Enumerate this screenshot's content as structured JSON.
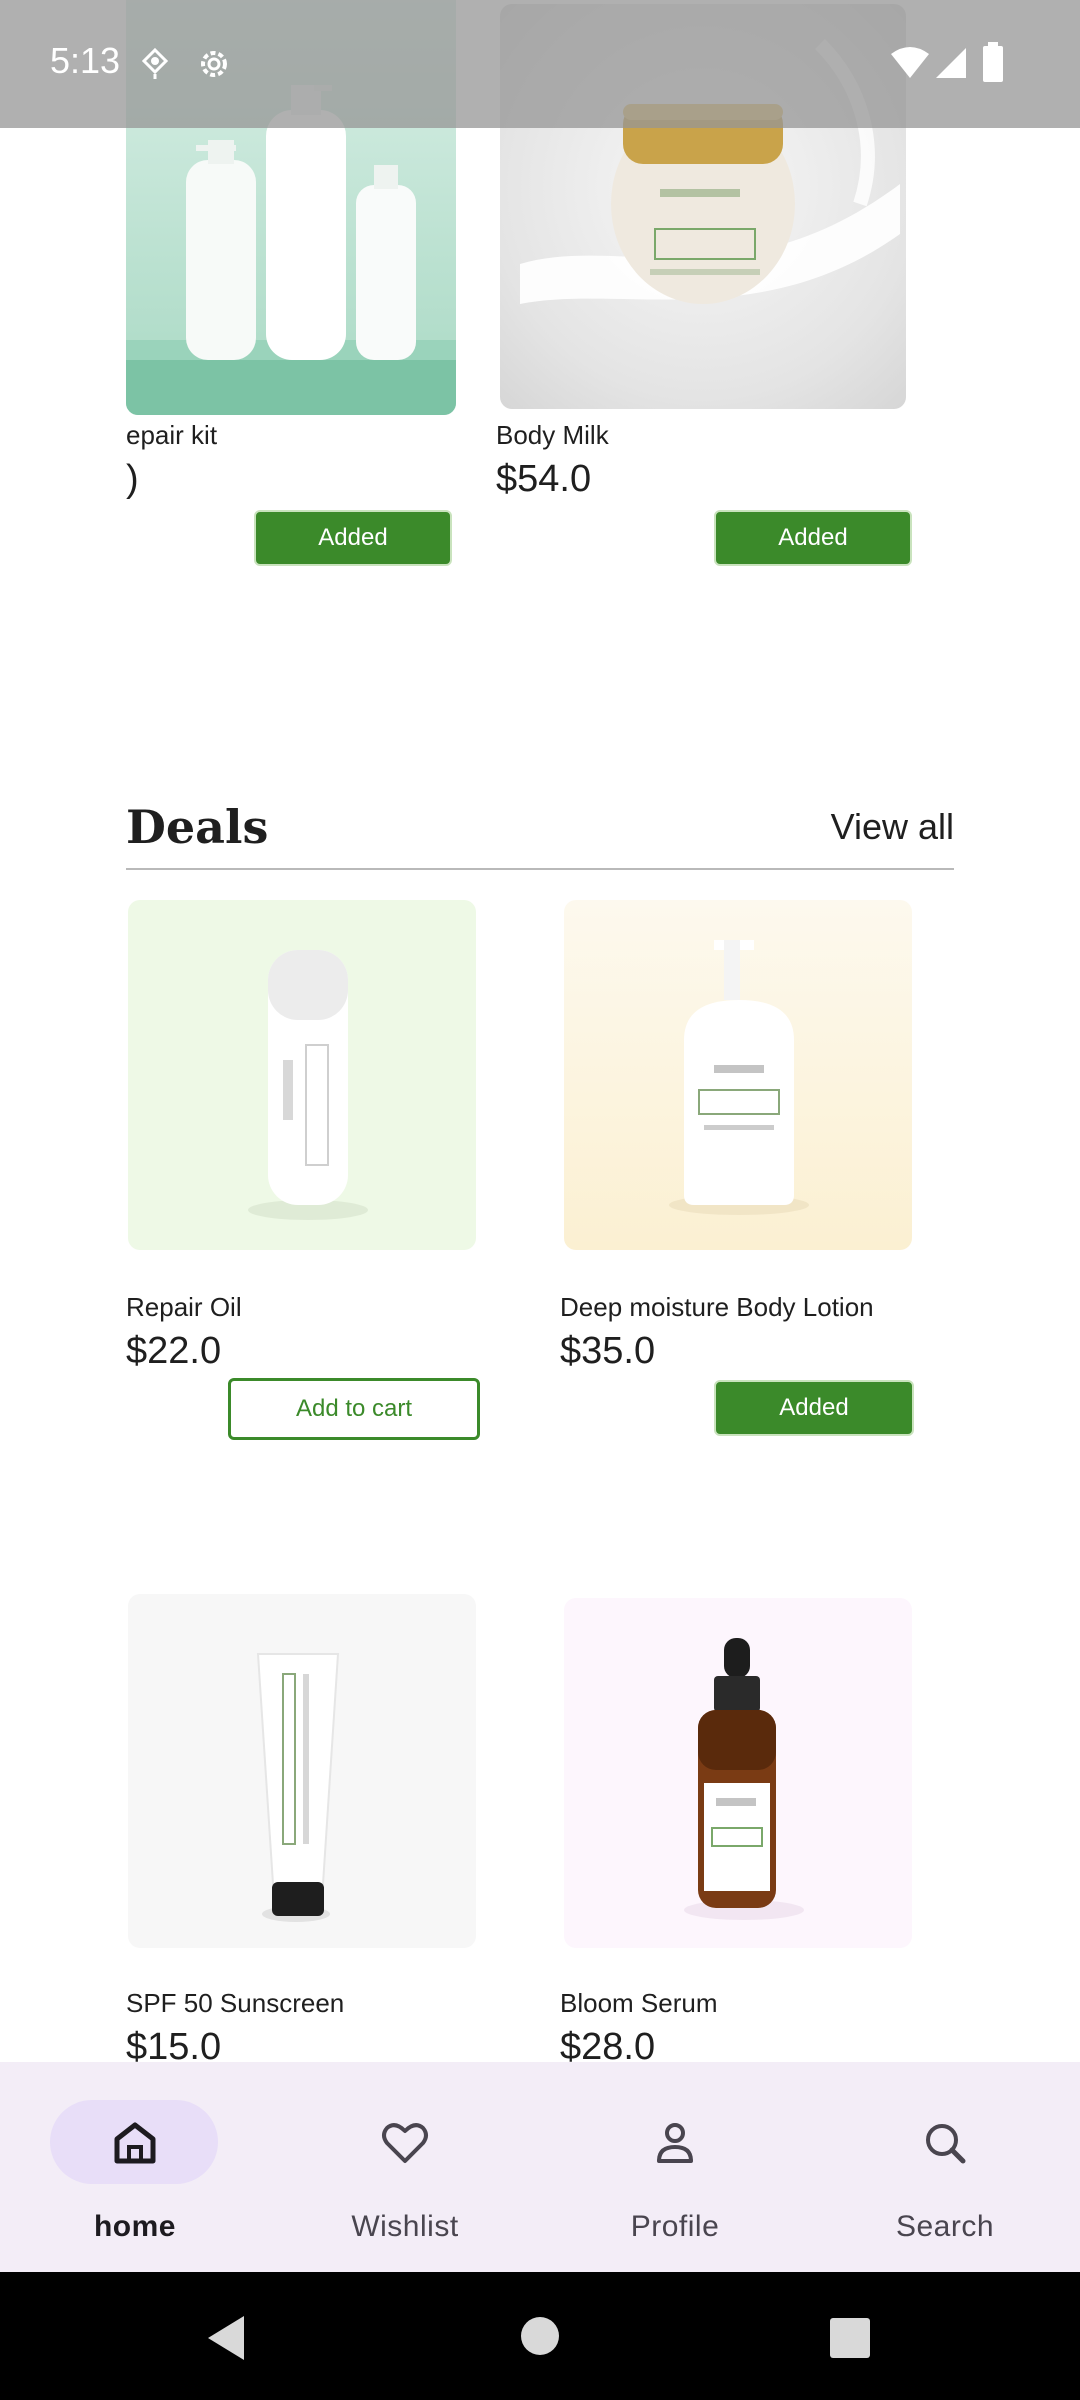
{
  "status_bar": {
    "time": "5:13",
    "icons": [
      "location-pin-icon",
      "gear-icon",
      "wifi-icon",
      "signal-icon",
      "battery-icon"
    ]
  },
  "top_products": [
    {
      "name": "epair kit",
      "price": ")",
      "button": "Added",
      "image": "pump-bottles-on-mint-image"
    },
    {
      "name": "Body Milk",
      "price": "$54.0",
      "button": "Added",
      "image": "cream-jar-milk-splash-image"
    }
  ],
  "deals": {
    "title": "Deals",
    "view_all": "View all",
    "products": [
      {
        "name": "Repair Oil",
        "price": "$22.0",
        "button": "Add to cart",
        "image": "white-airless-bottle-image"
      },
      {
        "name": "Deep moisture Body Lotion",
        "price": "$35.0",
        "button": "Added",
        "image": "white-pump-lotion-bottle-image"
      },
      {
        "name": "SPF 50 Sunscreen",
        "price": "$15.0",
        "image": "white-tube-image"
      },
      {
        "name": "Bloom Serum",
        "price": "$28.0",
        "image": "amber-dropper-bottle-image"
      }
    ]
  },
  "bottom_nav": {
    "items": [
      {
        "label": "home",
        "icon": "home-icon",
        "active": true
      },
      {
        "label": "Wishlist",
        "icon": "heart-icon",
        "active": false
      },
      {
        "label": "Profile",
        "icon": "person-icon",
        "active": false
      },
      {
        "label": "Search",
        "icon": "search-icon",
        "active": false
      }
    ]
  },
  "colors": {
    "accent_green": "#3b8a2a",
    "nav_background": "#f3edf7",
    "nav_active_pill": "#e8def8"
  }
}
